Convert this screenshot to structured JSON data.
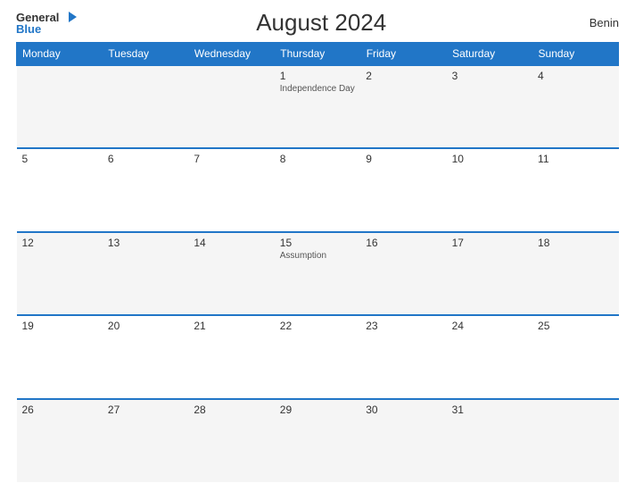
{
  "header": {
    "logo_general": "General",
    "logo_blue": "Blue",
    "title": "August 2024",
    "country": "Benin"
  },
  "weekdays": [
    "Monday",
    "Tuesday",
    "Wednesday",
    "Thursday",
    "Friday",
    "Saturday",
    "Sunday"
  ],
  "weeks": [
    [
      {
        "day": "",
        "event": ""
      },
      {
        "day": "",
        "event": ""
      },
      {
        "day": "",
        "event": ""
      },
      {
        "day": "1",
        "event": "Independence Day"
      },
      {
        "day": "2",
        "event": ""
      },
      {
        "day": "3",
        "event": ""
      },
      {
        "day": "4",
        "event": ""
      }
    ],
    [
      {
        "day": "5",
        "event": ""
      },
      {
        "day": "6",
        "event": ""
      },
      {
        "day": "7",
        "event": ""
      },
      {
        "day": "8",
        "event": ""
      },
      {
        "day": "9",
        "event": ""
      },
      {
        "day": "10",
        "event": ""
      },
      {
        "day": "11",
        "event": ""
      }
    ],
    [
      {
        "day": "12",
        "event": ""
      },
      {
        "day": "13",
        "event": ""
      },
      {
        "day": "14",
        "event": ""
      },
      {
        "day": "15",
        "event": "Assumption"
      },
      {
        "day": "16",
        "event": ""
      },
      {
        "day": "17",
        "event": ""
      },
      {
        "day": "18",
        "event": ""
      }
    ],
    [
      {
        "day": "19",
        "event": ""
      },
      {
        "day": "20",
        "event": ""
      },
      {
        "day": "21",
        "event": ""
      },
      {
        "day": "22",
        "event": ""
      },
      {
        "day": "23",
        "event": ""
      },
      {
        "day": "24",
        "event": ""
      },
      {
        "day": "25",
        "event": ""
      }
    ],
    [
      {
        "day": "26",
        "event": ""
      },
      {
        "day": "27",
        "event": ""
      },
      {
        "day": "28",
        "event": ""
      },
      {
        "day": "29",
        "event": ""
      },
      {
        "day": "30",
        "event": ""
      },
      {
        "day": "31",
        "event": ""
      },
      {
        "day": "",
        "event": ""
      }
    ]
  ]
}
